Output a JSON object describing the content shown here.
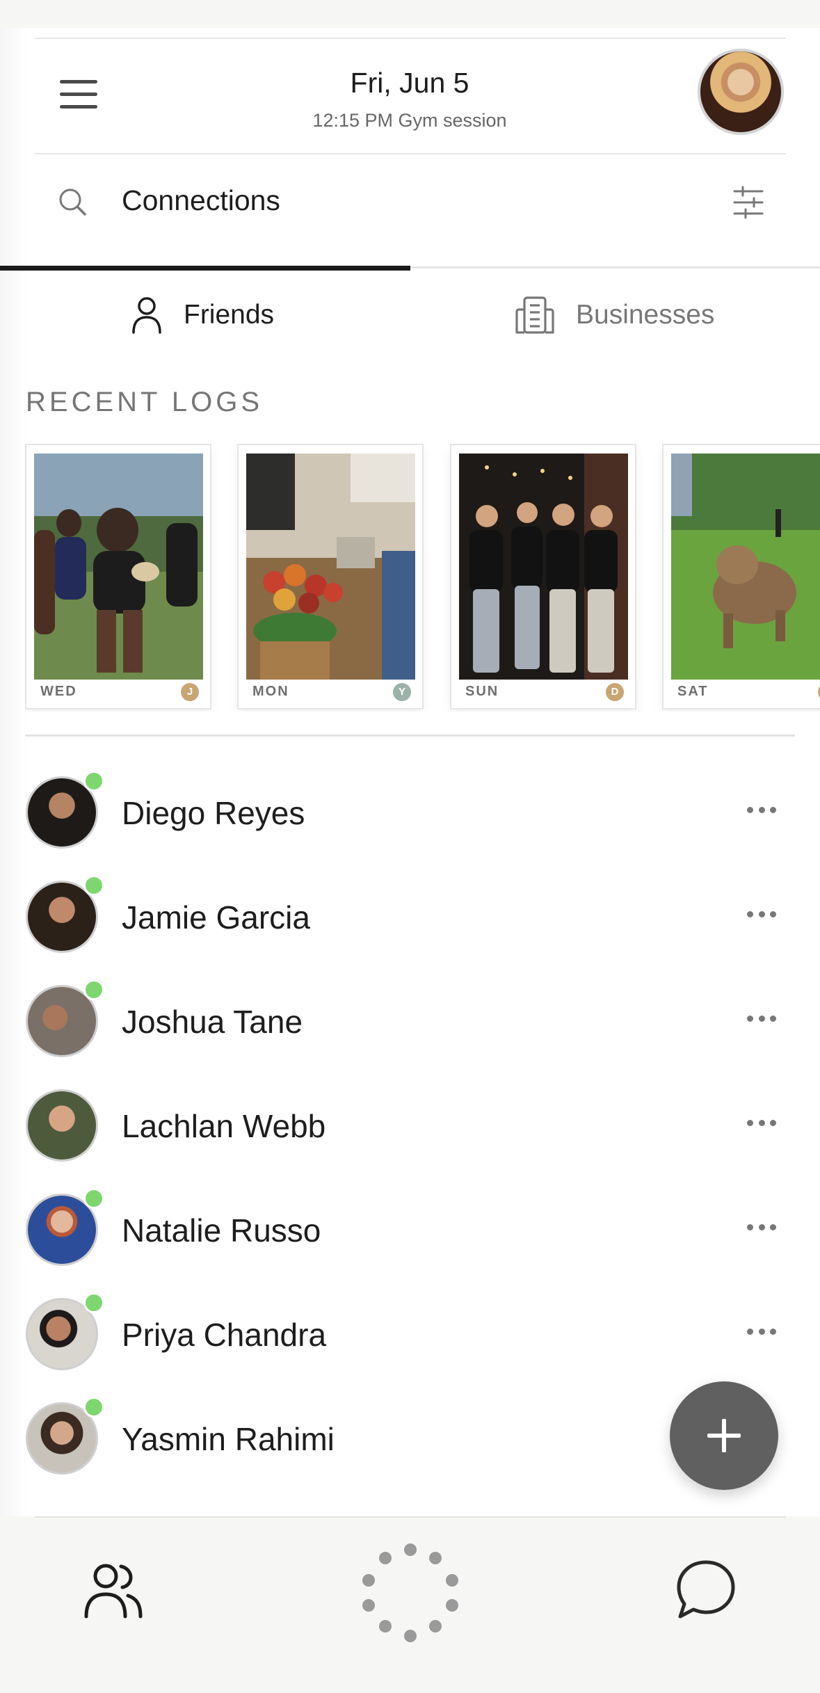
{
  "header": {
    "date": "Fri, Jun 5",
    "subtitle": "12:15 PM Gym session"
  },
  "search": {
    "label": "Connections"
  },
  "tabs": [
    {
      "label": "Friends",
      "active": true,
      "icon": "user-icon"
    },
    {
      "label": "Businesses",
      "active": false,
      "icon": "building-icon"
    }
  ],
  "recent_logs": {
    "title": "RECENT LOGS",
    "items": [
      {
        "day": "WED",
        "badge": "J",
        "badge_color": "#c9a574",
        "photo": "rugby-players-photo"
      },
      {
        "day": "MON",
        "badge": "Y",
        "badge_color": "#9bb2a8",
        "photo": "market-produce-photo"
      },
      {
        "day": "SUN",
        "badge": "D",
        "badge_color": "#c9a574",
        "photo": "friends-alley-photo"
      },
      {
        "day": "SAT",
        "badge": "",
        "badge_color": "#c9a574",
        "photo": "dog-park-photo"
      }
    ]
  },
  "friends": [
    {
      "name": "Diego Reyes",
      "online": true
    },
    {
      "name": "Jamie Garcia",
      "online": true
    },
    {
      "name": "Joshua Tane",
      "online": true
    },
    {
      "name": "Lachlan Webb",
      "online": false
    },
    {
      "name": "Natalie Russo",
      "online": true
    },
    {
      "name": "Priya Chandra",
      "online": true
    },
    {
      "name": "Yasmin Rahimi",
      "online": true
    }
  ],
  "bottom_nav": {
    "items": [
      "friends-icon",
      "loading-spinner-icon",
      "chat-icon"
    ]
  },
  "colors": {
    "online": "#7ed66f",
    "fab": "#606060",
    "active_tab": "#1b1b1b"
  }
}
